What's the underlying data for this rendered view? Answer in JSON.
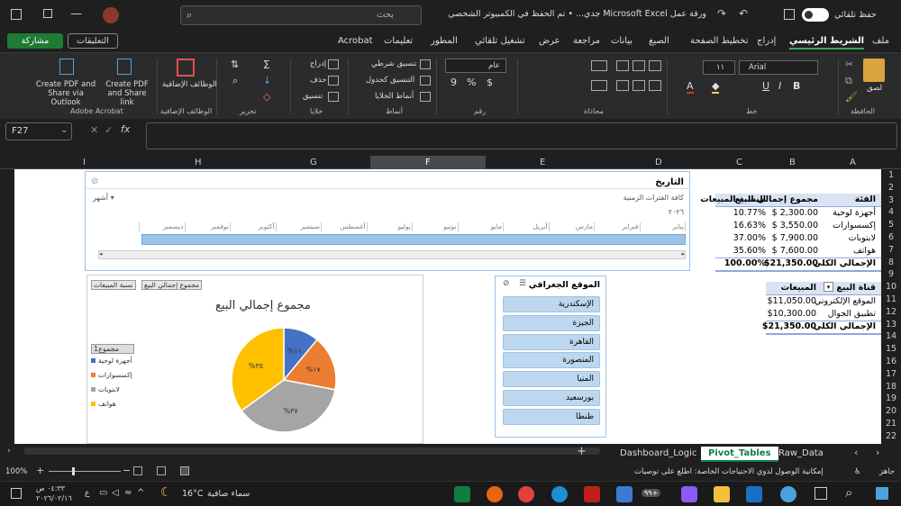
{
  "window": {
    "title": "ورقة عمل Microsoft Excel جدي... • تم الحفظ في الكمبيوتر الشخصي هذا",
    "autosave_label": "حفظ تلقائي",
    "search_placeholder": "بحث"
  },
  "ribbon_tabs": [
    "ملف",
    "الشريط الرئيسي",
    "إدراج",
    "تخطيط الصفحة",
    "الصيغ",
    "بيانات",
    "مراجعة",
    "عرض",
    "تشغيل تلقائي",
    "المطور",
    "تعليمات",
    "Acrobat"
  ],
  "ribbon_right": {
    "comments": "التعليقات",
    "share": "مشاركة"
  },
  "ribbon": {
    "paste": "لصق",
    "font_name": "Arial",
    "font_size": "١١",
    "number_format": "عام",
    "cond_format": "تنسيق شرطي",
    "format_table": "التنسيق كجدول",
    "cell_styles": "أنماط الخلايا",
    "insert": "إدراج",
    "delete": "حذف",
    "format": "تنسيق",
    "addins": "الوظائف الإضافية",
    "pdf_outlook": "Create PDF and Share via Outlook",
    "pdf_link": "Create PDF and Share link",
    "groups": {
      "clipboard": "الحافظة",
      "font": "خط",
      "alignment": "محاذاة",
      "number": "رقم",
      "styles": "أنماط",
      "cells": "خلايا",
      "editing": "تحرير",
      "addins": "الوظائف الإضافية",
      "acrobat": "Adobe Acrobat"
    }
  },
  "formula_bar": {
    "name_box": "F27",
    "formula": ""
  },
  "columns": [
    "A",
    "B",
    "C",
    "D",
    "E",
    "F",
    "G",
    "H",
    "I"
  ],
  "rows": [
    "1",
    "2",
    "3",
    "4",
    "5",
    "6",
    "7",
    "8",
    "9",
    "10",
    "11",
    "12",
    "13",
    "14",
    "15",
    "16",
    "17",
    "18",
    "19",
    "20",
    "21",
    "22"
  ],
  "pivot1": {
    "headers": [
      "الفئة",
      "مجموع إجمالي البيع",
      "النسبة المبيعات"
    ],
    "rows": [
      [
        "أجهزة لوحية",
        "$  2,300.00",
        "10.77%"
      ],
      [
        "إكسسوارات",
        "$  3,550.00",
        "16.63%"
      ],
      [
        "لابتوبات",
        "$  7,900.00",
        "37.00%"
      ],
      [
        "هواتف",
        "$  7,600.00",
        "35.60%"
      ]
    ],
    "total": [
      "الإجمالي الكلي",
      "$21,350.00",
      "100.00%"
    ]
  },
  "pivot2": {
    "headers": [
      "قناة البيع",
      "المبيعات"
    ],
    "rows": [
      [
        "الموقع الإلكتروني",
        "$11,050.00"
      ],
      [
        "تطبيق الجوال",
        "$10,300.00"
      ]
    ],
    "total": [
      "الإجمالي الكلي",
      "$21,350.00"
    ]
  },
  "timeline": {
    "title": "التاريخ",
    "subtitle": "كافة الفترات الزمنية",
    "unit": "أشهر",
    "year": "٢٠٢٦",
    "months": [
      "يناير",
      "فبراير",
      "مارس",
      "أبريل",
      "مايو",
      "يونيو",
      "يوليو",
      "أغسطس",
      "سبتمبر",
      "أكتوبر",
      "نوفمبر",
      "ديسمبر"
    ]
  },
  "slicer": {
    "title": "الموقع الجغرافي",
    "items": [
      "الإسكندرية",
      "الجيزة",
      "القاهرة",
      "المنصورة",
      "المنيا",
      "بورسعيد",
      "طنطا"
    ]
  },
  "chart_data": {
    "type": "pie",
    "title": "مجموع إجمالي البيع",
    "field_buttons": [
      "مجموع إجمالي البيع",
      "نسبة المبيعات"
    ],
    "legend_title": "مجموع1",
    "categories": [
      "أجهزة لوحية",
      "إكسسوارات",
      "لابتوبات",
      "هواتف"
    ],
    "values": [
      11,
      17,
      37,
      35
    ],
    "labels": [
      "%١١",
      "%١٧",
      "%٣٧",
      "%٣٥"
    ],
    "colors": [
      "#4472c4",
      "#ed7d31",
      "#a5a5a5",
      "#ffc000"
    ]
  },
  "sheets": [
    "Dashboard_Logic",
    "Pivot_Tables",
    "Raw_Data"
  ],
  "active_sheet": "Pivot_Tables",
  "status": {
    "ready": "جاهز",
    "accessibility": "إمكانية الوصول لذوي الاحتياجات الخاصة: اطلع على توصيات",
    "zoom": "100%"
  },
  "taskbar": {
    "weather_desc": "سماء صافية",
    "temp": "16°C",
    "time": "٠٤:٣٣ ص",
    "date": "٢٠٢٦/٠٢/١٦",
    "lang": "ع",
    "badge": "٩٩+"
  }
}
